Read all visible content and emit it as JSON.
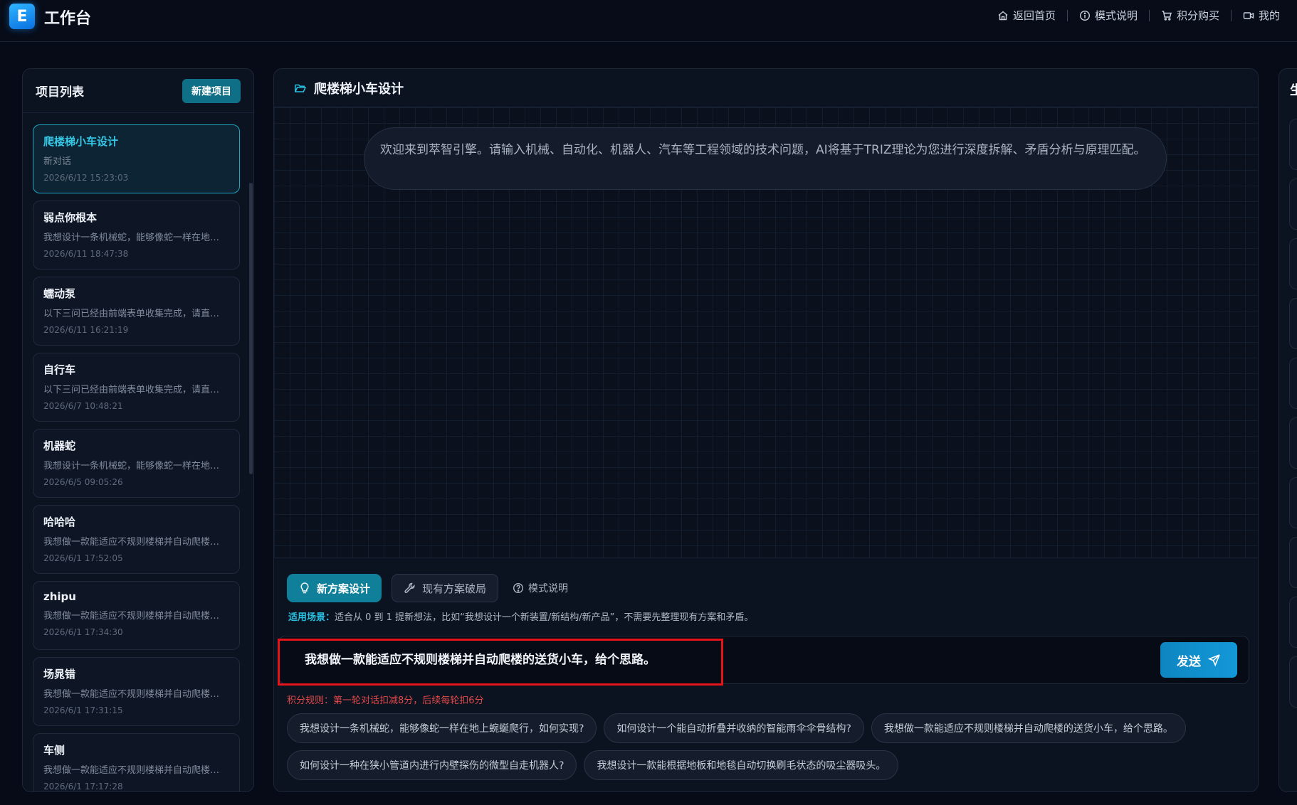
{
  "app": {
    "logo_letter": "E",
    "title": "工作台"
  },
  "topnav": [
    {
      "label": "返回首页",
      "icon": "home-icon"
    },
    {
      "label": "模式说明",
      "icon": "info-icon"
    },
    {
      "label": "积分购买",
      "icon": "cart-icon"
    },
    {
      "label": "我的",
      "icon": "video-icon"
    }
  ],
  "projects": {
    "title": "项目列表",
    "new_button": "新建项目",
    "items": [
      {
        "name": "爬楼梯小车设计",
        "desc": "新对话",
        "time": "2026/6/12 15:23:03",
        "active": true
      },
      {
        "name": "弱点你根本",
        "desc": "我想设计一条机械蛇，能够像蛇一样在地…",
        "time": "2026/6/11 18:47:38"
      },
      {
        "name": "蠕动泵",
        "desc": "以下三问已经由前端表单收集完成，请直…",
        "time": "2026/6/11 16:21:19"
      },
      {
        "name": "自行车",
        "desc": "以下三问已经由前端表单收集完成，请直…",
        "time": "2026/6/7 10:48:21"
      },
      {
        "name": "机器蛇",
        "desc": "我想设计一条机械蛇，能够像蛇一样在地…",
        "time": "2026/6/5 09:05:26"
      },
      {
        "name": "哈哈哈",
        "desc": "我想做一款能适应不规则楼梯并自动爬楼…",
        "time": "2026/6/1 17:52:05"
      },
      {
        "name": "zhipu",
        "desc": "我想做一款能适应不规则楼梯并自动爬楼…",
        "time": "2026/6/1 17:34:30"
      },
      {
        "name": "场晁错",
        "desc": "我想做一款能适应不规则楼梯并自动爬楼…",
        "time": "2026/6/1 17:31:15"
      },
      {
        "name": "车侧",
        "desc": "我想做一款能适应不规则楼梯并自动爬楼…",
        "time": "2026/6/1 17:17:28"
      }
    ]
  },
  "chat": {
    "title": "爬楼梯小车设计",
    "welcome": "欢迎来到萃智引擎。请输入机械、自动化、机器人、汽车等工程领域的技术问题，AI将基于TRIZ理论为您进行深度拆解、矛盾分析与原理匹配。",
    "modes": {
      "primary": "新方案设计",
      "secondary": "现有方案破局",
      "help": "模式说明"
    },
    "scene_label": "适用场景：",
    "scene_text": "适合从 0 到 1 提新想法，比如“我想设计一个新装置/新结构/新产品”，不需要先整理现有方案和矛盾。",
    "input_value": "我想做一款能适应不规则楼梯并自动爬楼的送货小车，给个思路。",
    "send_label": "发送",
    "rule_text": "积分规则：第一轮对话扣减8分，后续每轮扣6分",
    "suggestions": [
      "我想设计一条机械蛇，能够像蛇一样在地上蜿蜒爬行，如何实现?",
      "如何设计一个能自动折叠并收纳的智能雨伞伞骨结构?",
      "我想做一款能适应不规则楼梯并自动爬楼的送货小车，给个思路。",
      "如何设计一种在狭小管道内进行内壁探伤的微型自走机器人?",
      "我想设计一款能根据地板和地毯自动切换刷毛状态的吸尘器吸头。"
    ]
  },
  "right_panel": {
    "title_partial": "生"
  },
  "colors": {
    "accent": "#1fa7c0",
    "send": "#1398d8",
    "warning": "#e24a4a",
    "highlight": "#e5141b"
  }
}
